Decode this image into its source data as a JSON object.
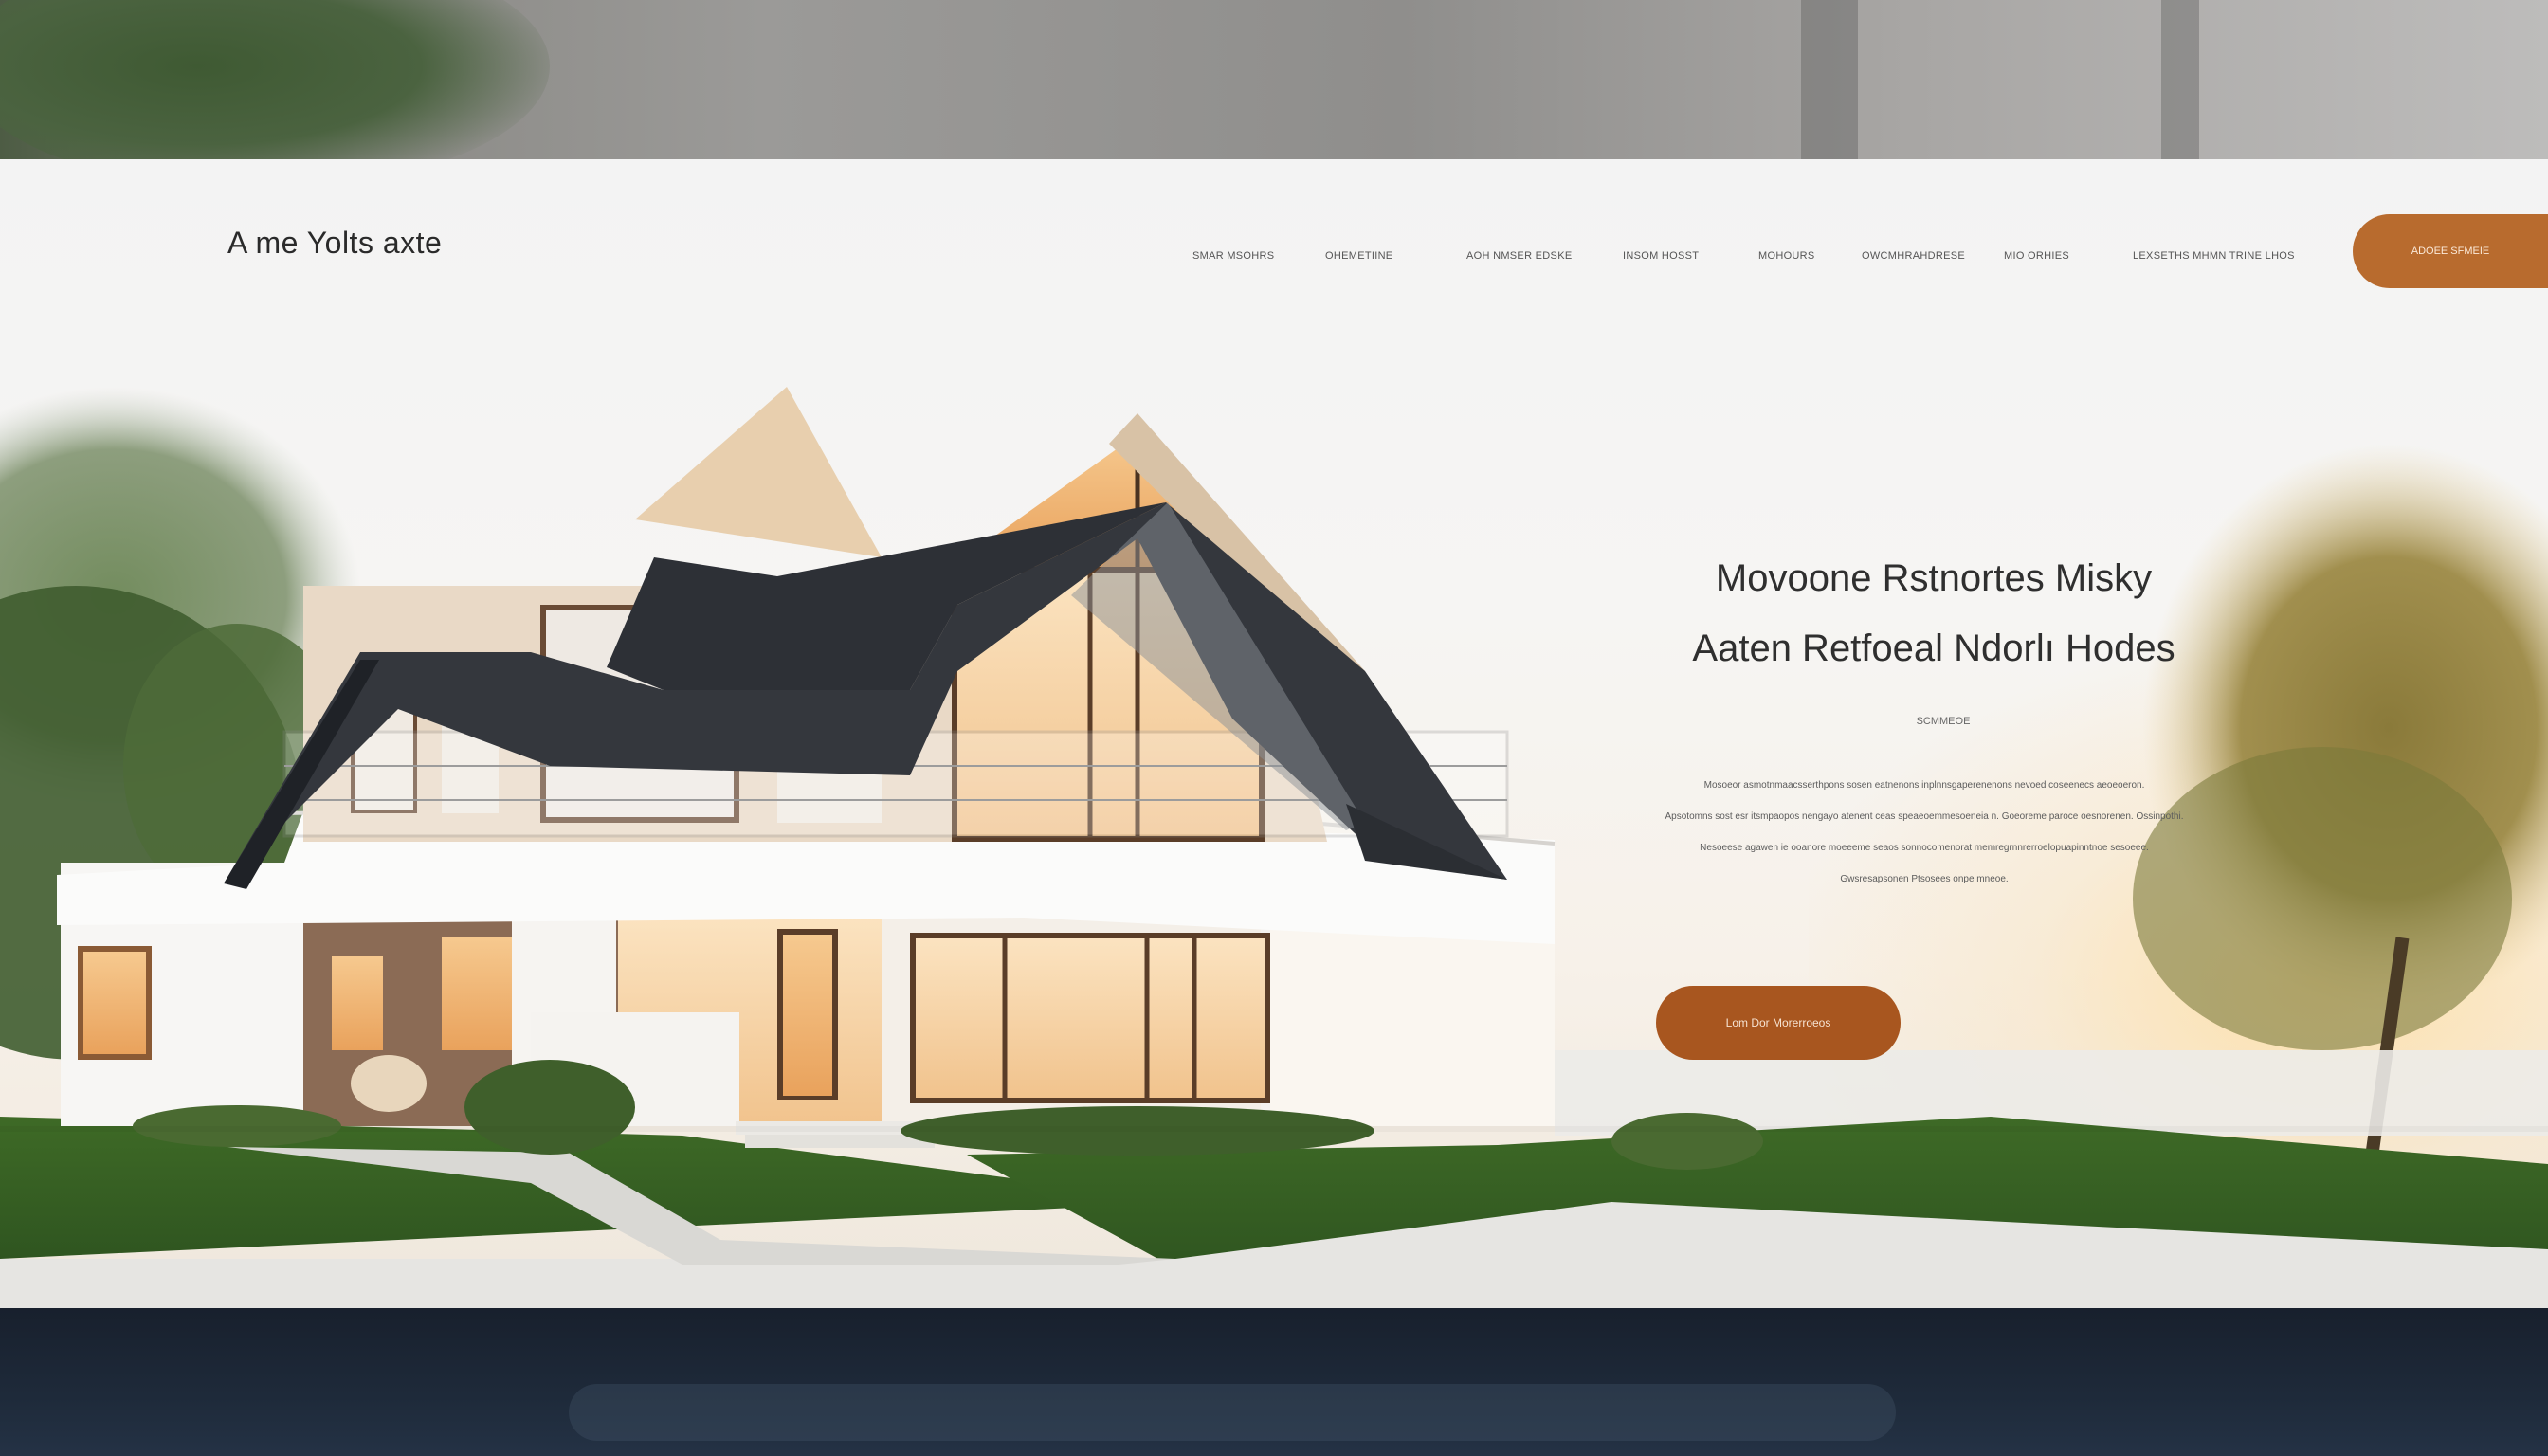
{
  "header": {
    "logo": "A me Yolts axte",
    "nav": [
      "SMAR MSOHRS",
      "OHEMETIINE",
      "AOH NMSER EDSKE",
      "INSOM HOSST",
      "MOHOURS",
      "OWCMHRAHDRESE",
      "MIO ORHIES",
      "LEXSETHS MHMN TRINE LHOS"
    ],
    "cta_label": "ADOEE SFMEIE"
  },
  "hero": {
    "title_line1": "Movoone Rstnortes Misky",
    "title_line2": "Aaten Retfoeal Ndorlı Hodes",
    "eyebrow": "SCMMEOE",
    "body_lines": [
      "Mosoeor asmotnmaacsserthpons sosen eatnenons inplnnsgaperenenons nevoed coseenecs aeoeoeron.",
      "Apsotomns sost esr itsmpaopos nengayo atenent ceas speaeoemmesoeneia n. Goeoreme paroce oesnorenen. Ossinpothi.",
      "Nesoeese agawen ie ooanore moeeeme seaos sonnocomenorat memregrnnrerroelopuapinntnoe sesoeee.",
      "Gwsresapsonen Ptsosees onpe mneoe."
    ],
    "cta_label": "Lom Dor Morerroeos"
  },
  "colors": {
    "accent": "#b86b2e",
    "accent_dark": "#a8561f",
    "text": "#2f2f2f",
    "footer": "#1e2a3a"
  }
}
